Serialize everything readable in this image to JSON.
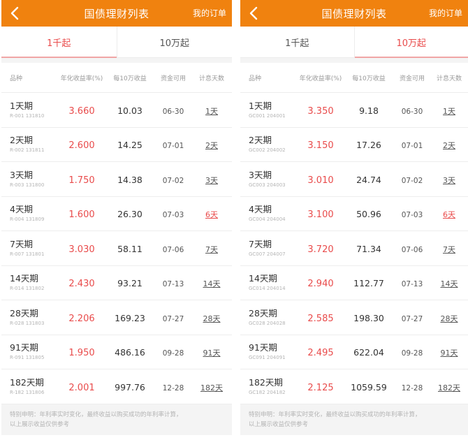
{
  "left": {
    "header": {
      "title": "国债理财列表",
      "orders": "我的订单"
    },
    "tabs": [
      {
        "label": "1千起",
        "active": true
      },
      {
        "label": "10万起",
        "active": false
      }
    ],
    "columns": {
      "name": "品种",
      "rate": "年化收益率(%)",
      "earn": "每10万收益",
      "date": "资金可用",
      "days": "计息天数"
    },
    "rows": [
      {
        "name": "1天期",
        "code": "R-001 131810",
        "rate": "3.660",
        "earn": "10.03",
        "date": "06-30",
        "days": "1天",
        "hot": false
      },
      {
        "name": "2天期",
        "code": "R-002 131811",
        "rate": "2.600",
        "earn": "14.25",
        "date": "07-01",
        "days": "2天",
        "hot": false
      },
      {
        "name": "3天期",
        "code": "R-003 131800",
        "rate": "1.750",
        "earn": "14.38",
        "date": "07-02",
        "days": "3天",
        "hot": false
      },
      {
        "name": "4天期",
        "code": "R-004 131809",
        "rate": "1.600",
        "earn": "26.30",
        "date": "07-03",
        "days": "6天",
        "hot": true
      },
      {
        "name": "7天期",
        "code": "R-007 131801",
        "rate": "3.030",
        "earn": "58.11",
        "date": "07-06",
        "days": "7天",
        "hot": false
      },
      {
        "name": "14天期",
        "code": "R-014 131802",
        "rate": "2.430",
        "earn": "93.21",
        "date": "07-13",
        "days": "14天",
        "hot": false
      },
      {
        "name": "28天期",
        "code": "R-028 131803",
        "rate": "2.206",
        "earn": "169.23",
        "date": "07-27",
        "days": "28天",
        "hot": false
      },
      {
        "name": "91天期",
        "code": "R-091 131805",
        "rate": "1.950",
        "earn": "486.16",
        "date": "09-28",
        "days": "91天",
        "hot": false
      },
      {
        "name": "182天期",
        "code": "R-182 131806",
        "rate": "2.001",
        "earn": "997.76",
        "date": "12-28",
        "days": "182天",
        "hot": false
      }
    ],
    "note": [
      "特别申明：年利率实时变化，最终收益以购买成功的年利率计算，",
      "以上展示收益仅供参考"
    ]
  },
  "right": {
    "header": {
      "title": "国债理财列表",
      "orders": "我的订单"
    },
    "tabs": [
      {
        "label": "1千起",
        "active": false
      },
      {
        "label": "10万起",
        "active": true
      }
    ],
    "columns": {
      "name": "品种",
      "rate": "年化收益率(%)",
      "earn": "每10万收益",
      "date": "资金可用",
      "days": "计息天数"
    },
    "rows": [
      {
        "name": "1天期",
        "code": "GC001 204001",
        "rate": "3.350",
        "earn": "9.18",
        "date": "06-30",
        "days": "1天",
        "hot": false
      },
      {
        "name": "2天期",
        "code": "GC002 204002",
        "rate": "3.150",
        "earn": "17.26",
        "date": "07-01",
        "days": "2天",
        "hot": false
      },
      {
        "name": "3天期",
        "code": "GC003 204003",
        "rate": "3.010",
        "earn": "24.74",
        "date": "07-02",
        "days": "3天",
        "hot": false
      },
      {
        "name": "4天期",
        "code": "GC004 204004",
        "rate": "3.100",
        "earn": "50.96",
        "date": "07-03",
        "days": "6天",
        "hot": true
      },
      {
        "name": "7天期",
        "code": "GC007 204007",
        "rate": "3.720",
        "earn": "71.34",
        "date": "07-06",
        "days": "7天",
        "hot": false
      },
      {
        "name": "14天期",
        "code": "GC014 204014",
        "rate": "2.940",
        "earn": "112.77",
        "date": "07-13",
        "days": "14天",
        "hot": false
      },
      {
        "name": "28天期",
        "code": "GC028 204028",
        "rate": "2.585",
        "earn": "198.30",
        "date": "07-27",
        "days": "28天",
        "hot": false
      },
      {
        "name": "91天期",
        "code": "GC091 204091",
        "rate": "2.495",
        "earn": "622.04",
        "date": "09-28",
        "days": "91天",
        "hot": false
      },
      {
        "name": "182天期",
        "code": "GC182 204182",
        "rate": "2.125",
        "earn": "1059.59",
        "date": "12-28",
        "days": "182天",
        "hot": false
      }
    ],
    "note": [
      "特别申明：年利率实时变化，最终收益以购买成功的年利率计算，",
      "以上展示收益仅供参考"
    ]
  },
  "colors": {
    "header": "#f0820f",
    "accent": "#e94b4b"
  }
}
